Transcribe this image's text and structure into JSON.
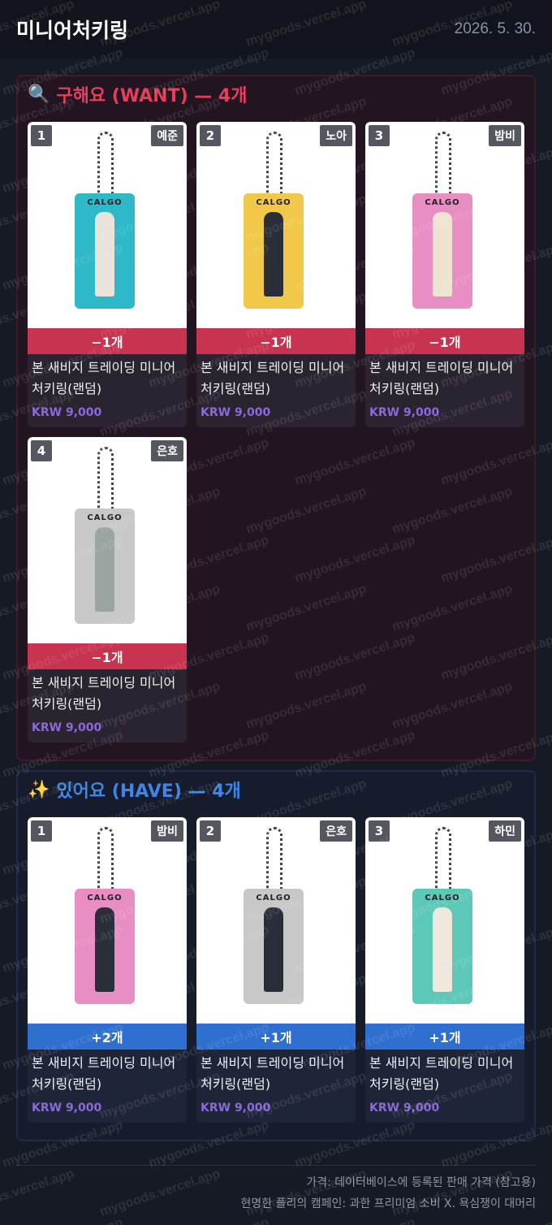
{
  "header": {
    "title": "미니어처키링",
    "date": "2026. 5. 30."
  },
  "want": {
    "icon": "🔍",
    "title": "구해요 (WANT) — 4개",
    "items": [
      {
        "rank": "1",
        "member": "예준",
        "qty": "−1개",
        "name": "본 새비지 트레이딩 미니어처키링(랜덤)",
        "price": "KRW 9,000",
        "color": "#2fb8c8",
        "figure": "#e8e4dc"
      },
      {
        "rank": "2",
        "member": "노아",
        "qty": "−1개",
        "name": "본 새비지 트레이딩 미니어처키링(랜덤)",
        "price": "KRW 9,000",
        "color": "#f2c84a",
        "figure": "#2a2e38"
      },
      {
        "rank": "3",
        "member": "밤비",
        "qty": "−1개",
        "name": "본 새비지 트레이딩 미니어처키링(랜덤)",
        "price": "KRW 9,000",
        "color": "#e88ec4",
        "figure": "#eee4d0"
      },
      {
        "rank": "4",
        "member": "은호",
        "qty": "−1개",
        "name": "본 새비지 트레이딩 미니어처키링(랜덤)",
        "price": "KRW 9,000",
        "color": "#c8c8c8",
        "figure": "#9aa4a0"
      }
    ]
  },
  "have": {
    "icon": "✨",
    "title": "있어요 (HAVE) — 4개",
    "items": [
      {
        "rank": "1",
        "member": "밤비",
        "qty": "+2개",
        "name": "본 새비지 트레이딩 미니어처키링(랜덤)",
        "price": "KRW 9,000",
        "color": "#e88ec4",
        "figure": "#2a2e38"
      },
      {
        "rank": "2",
        "member": "은호",
        "qty": "+1개",
        "name": "본 새비지 트레이딩 미니어처키링(랜덤)",
        "price": "KRW 9,000",
        "color": "#c8c8c8",
        "figure": "#2a2e38"
      },
      {
        "rank": "3",
        "member": "하민",
        "qty": "+1개",
        "name": "본 새비지 트레이딩 미니어처키링(랜덤)",
        "price": "KRW 9,000",
        "color": "#5ec8b8",
        "figure": "#eee8dc"
      }
    ]
  },
  "keyring_logo": "CALGO",
  "watermark": "mygoods.vercel.app",
  "footer": {
    "line1": "가격: 데이터베이스에 등록된 판매 가격 (참고용)",
    "line2": "현명한 플리의 캠페인: 과한 프리미엄 소비 X. 욕심쟁이 대머리"
  }
}
